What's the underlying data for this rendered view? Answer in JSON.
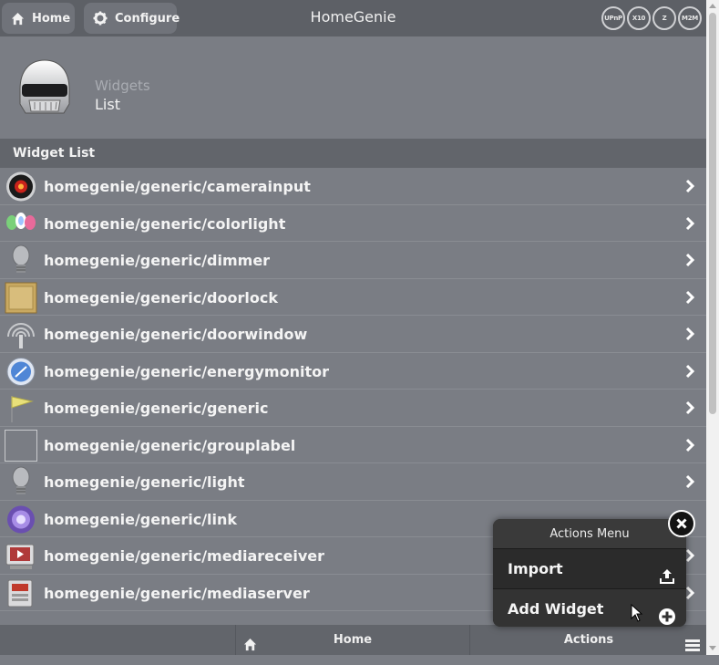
{
  "header": {
    "home_label": "Home",
    "configure_label": "Configure",
    "app_title": "HomeGenie",
    "status_icons": [
      {
        "name": "upnp-icon",
        "text": "UPnP"
      },
      {
        "name": "x10-icon",
        "text": "X10"
      },
      {
        "name": "zwave-icon",
        "text": "Z"
      },
      {
        "name": "m2m-icon",
        "text": "M2M"
      }
    ]
  },
  "page": {
    "subtitle": "Widgets",
    "title": "List"
  },
  "list": {
    "header": "Widget List",
    "items": [
      {
        "label": "homegenie/generic/camerainput",
        "icon": "camera-icon"
      },
      {
        "label": "homegenie/generic/colorlight",
        "icon": "colorlight-icon"
      },
      {
        "label": "homegenie/generic/dimmer",
        "icon": "bulb-icon"
      },
      {
        "label": "homegenie/generic/doorlock",
        "icon": "door-icon"
      },
      {
        "label": "homegenie/generic/doorwindow",
        "icon": "sensor-icon"
      },
      {
        "label": "homegenie/generic/energymonitor",
        "icon": "energy-icon"
      },
      {
        "label": "homegenie/generic/generic",
        "icon": "flag-icon"
      },
      {
        "label": "homegenie/generic/grouplabel",
        "icon": "blank-icon"
      },
      {
        "label": "homegenie/generic/light",
        "icon": "bulb-icon"
      },
      {
        "label": "homegenie/generic/link",
        "icon": "link-icon"
      },
      {
        "label": "homegenie/generic/mediareceiver",
        "icon": "mediareceiver-icon"
      },
      {
        "label": "homegenie/generic/mediaserver",
        "icon": "mediaserver-icon"
      }
    ]
  },
  "footer": {
    "home_label": "Home",
    "actions_label": "Actions"
  },
  "actions_menu": {
    "title": "Actions Menu",
    "import_label": "Import",
    "add_widget_label": "Add Widget"
  }
}
